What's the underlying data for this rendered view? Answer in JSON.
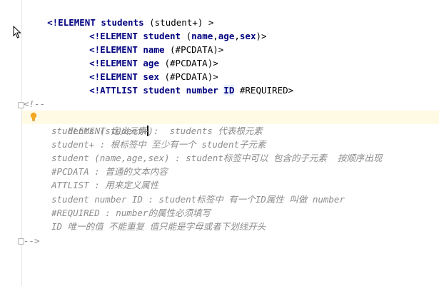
{
  "editor": {
    "dtd_lines": [
      {
        "open": "<!",
        "keyword": "ELEMENT",
        "name": "students",
        "rest": " (student+) >"
      },
      {
        "open": "<!",
        "keyword": "ELEMENT",
        "name": "student",
        "rest_open": " (",
        "children": [
          "name",
          "age",
          "sex"
        ],
        "rest_close": ")>"
      },
      {
        "open": "<!",
        "keyword": "ELEMENT",
        "name": "name",
        "rest": " (#PCDATA)>"
      },
      {
        "open": "<!",
        "keyword": "ELEMENT",
        "name": "age",
        "rest": " (#PCDATA)>"
      },
      {
        "open": "<!",
        "keyword": "ELEMENT",
        "name": "sex",
        "rest": " (#PCDATA)>"
      },
      {
        "open": "<!",
        "keyword": "ATTLIST",
        "name": "student",
        "attr": "number",
        "type": "ID",
        "rest": " #REQUIRED>"
      }
    ],
    "comment_open": "<!--",
    "comment_lines": [
      "ELEMENT 定义元素",
      "students (student+):  students 代表根元素",
      "student+ : 根标签中 至少有一个 student子元素",
      "student (name,age,sex) : student标签中可以 包含的子元素  按顺序出现",
      "#PCDATA : 普通的文本内容",
      "ATTLIST : 用来定义属性",
      "student number ID : student标签中 有一个ID属性 叫做 number",
      "#REQUIRED : number的属性必须填写",
      "ID 唯一的值 不能重复 值只能是字母或者下划线开头"
    ],
    "comment_close": "-->",
    "gutter_icons": [
      "intention-bulb-icon",
      "fold-icon",
      "mouse-cursor-icon"
    ]
  },
  "colors": {
    "keyword": "#000080",
    "comment": "#8c8c8c",
    "current_line": "#fffae3",
    "bulb": "#f5a623"
  }
}
